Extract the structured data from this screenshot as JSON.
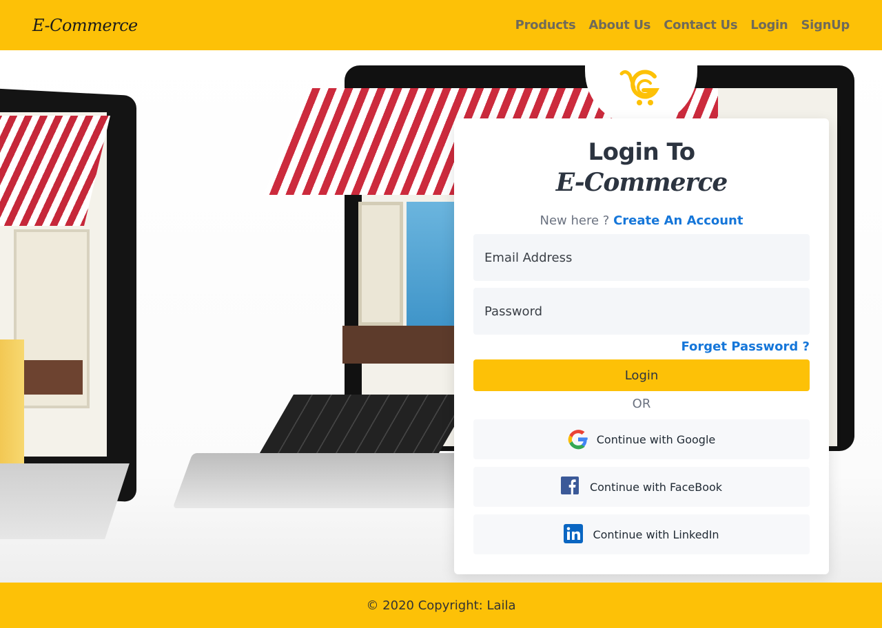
{
  "header": {
    "brand": "E-Commerce",
    "nav": [
      "Products",
      "About Us",
      "Contact Us",
      "Login",
      "SignUp"
    ]
  },
  "card": {
    "title": "Login To",
    "brand": "E-Commerce",
    "new_here": "New here ?",
    "create_account": "Create An Account",
    "email_placeholder": "Email Address",
    "password_placeholder": "Password",
    "forget_password": "Forget Password ?",
    "login_button": "Login",
    "or": "OR",
    "google": "Continue with Google",
    "facebook": "Continue with FaceBook",
    "linkedin": "Continue with LinkedIn"
  },
  "footer": {
    "copyright": "© 2020 Copyright: Laila"
  },
  "colors": {
    "accent": "#fdc107",
    "link": "#1576d9",
    "google_blue": "#4285f4",
    "google_red": "#ea4335",
    "google_yellow": "#fbbc05",
    "google_green": "#34a853",
    "facebook": "#3b5998",
    "linkedin": "#0a66c2"
  },
  "icons": {
    "logo": "cart-logo-icon",
    "google": "google-icon",
    "facebook": "facebook-icon",
    "linkedin": "linkedin-icon"
  }
}
